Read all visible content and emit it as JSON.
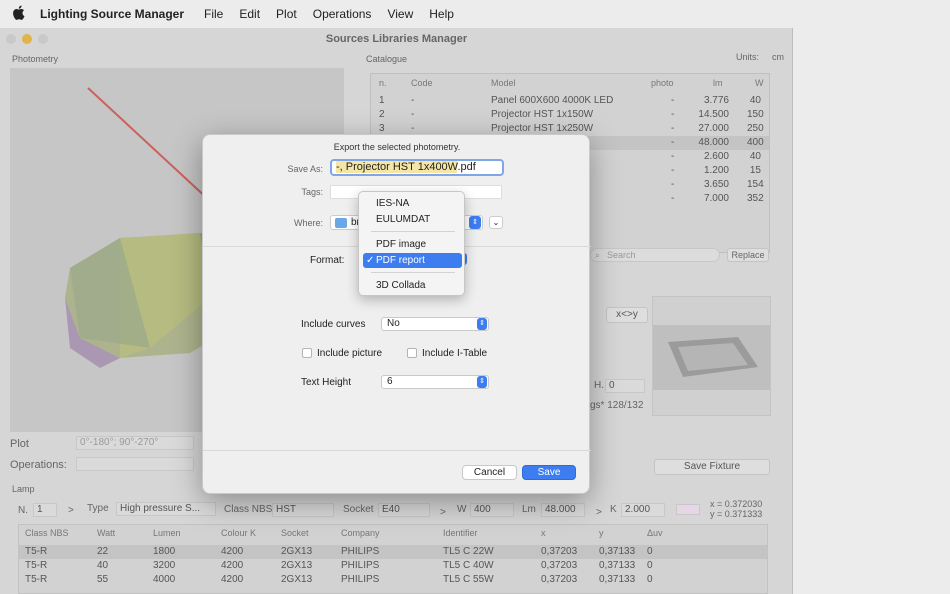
{
  "menubar": {
    "app_name": "Lighting Source Manager",
    "items": [
      "File",
      "Edit",
      "Plot",
      "Operations",
      "View",
      "Help"
    ]
  },
  "window": {
    "title": "Sources Libraries Manager",
    "photometry_label": "Photometry",
    "catalogue_label": "Catalogue",
    "units_label": "Units:",
    "units_value": "cm"
  },
  "catalogue": {
    "headers": [
      "n.",
      "Code",
      "Model",
      "photo",
      "lm",
      "W"
    ],
    "rows": [
      {
        "n": "1",
        "code": "-",
        "model": "Panel 600X600 4000K LED",
        "photo": "-",
        "lm": "3.776",
        "w": "40"
      },
      {
        "n": "2",
        "code": "-",
        "model": "Projector HST 1x150W",
        "photo": "-",
        "lm": "14.500",
        "w": "150"
      },
      {
        "n": "3",
        "code": "-",
        "model": "Projector HST 1x250W",
        "photo": "-",
        "lm": "27.000",
        "w": "250"
      },
      {
        "n": "",
        "code": "",
        "model": "",
        "photo": "-",
        "lm": "48.000",
        "w": "400"
      },
      {
        "n": "",
        "code": "",
        "model": "1x36W",
        "photo": "-",
        "lm": "2.600",
        "w": "40"
      },
      {
        "n": "",
        "code": "",
        "model": "",
        "photo": "-",
        "lm": "1.200",
        "w": "15"
      },
      {
        "n": "",
        "code": "",
        "model": "V",
        "photo": "-",
        "lm": "3.650",
        "w": "154"
      },
      {
        "n": "",
        "code": "",
        "model": "V",
        "photo": "-",
        "lm": "7.000",
        "w": "352"
      }
    ],
    "search_placeholder": "Search",
    "replace_label": "Replace",
    "xy_label": "x<>y",
    "h_label": "H.",
    "h_value": "0",
    "lgs_text": "gs*  128/132",
    "save_fixture_label": "Save Fixture"
  },
  "bottom_left": {
    "plot_label": "Plot",
    "plot_value": "0°-180°; 90°-270°",
    "operations_label": "Operations:"
  },
  "lamp": {
    "section_label": "Lamp",
    "n_label": "N.",
    "n_value": "1",
    "type_label": "Type",
    "type_value": "High pressure S...",
    "classnbs_label": "Class NBS",
    "classnbs_value": "HST",
    "socket_label": "Socket",
    "socket_value": "E40",
    "w_label": "W",
    "w_value": "400",
    "lm_label": "Lm",
    "lm_value": "48.000",
    "k_label": "K",
    "k_value": "2.000",
    "x_coord": "x = 0.372030",
    "y_coord": "y = 0.371333",
    "headers": [
      "Class NBS",
      "Watt",
      "Lumen",
      "Colour K",
      "Socket",
      "Company",
      "Identifier",
      "x",
      "y",
      "Δuv"
    ],
    "rows": [
      [
        "T5-R",
        "22",
        "1800",
        "4200",
        "2GX13",
        "PHILIPS",
        "TL5 C 22W",
        "0,37203",
        "0,37133",
        "0"
      ],
      [
        "T5-R",
        "40",
        "3200",
        "4200",
        "2GX13",
        "PHILIPS",
        "TL5 C 40W",
        "0,37203",
        "0,37133",
        "0"
      ],
      [
        "T5-R",
        "55",
        "4000",
        "4200",
        "2GX13",
        "PHILIPS",
        "TL5 C 55W",
        "0,37203",
        "0,37133",
        "0"
      ]
    ]
  },
  "dialog": {
    "message": "Export the selected photometry.",
    "save_as_label": "Save As:",
    "save_as_value_selected": "-, Projector HST 1x400W",
    "save_as_value_ext": ".pdf",
    "tags_label": "Tags:",
    "where_label": "Where:",
    "where_value": "br",
    "format_label": "Format:",
    "include_curves_label": "Include curves",
    "include_curves_value": "No",
    "include_picture_label": "Include picture",
    "include_itable_label": "Include I-Table",
    "text_height_label": "Text Height",
    "text_height_value": "6",
    "cancel_label": "Cancel",
    "save_label": "Save"
  },
  "format_menu": {
    "items": [
      "IES-NA",
      "EULUMDAT",
      "PDF image",
      "PDF report",
      "3D Collada"
    ],
    "selected": "PDF report",
    "check": "✓"
  },
  "colors": {
    "accent": "#3d7df0",
    "selection_highlight": "#f5e6a6"
  }
}
